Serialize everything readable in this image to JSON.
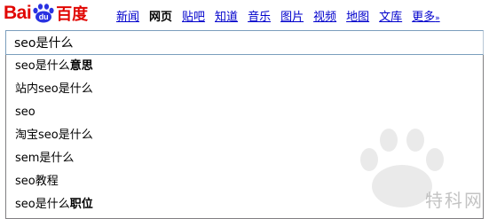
{
  "logo": {
    "text_left": "Bai",
    "text_paw": "du",
    "text_cn": "百度"
  },
  "nav": {
    "items": [
      {
        "label": "新闻",
        "active": false
      },
      {
        "label": "网页",
        "active": true
      },
      {
        "label": "贴吧",
        "active": false
      },
      {
        "label": "知道",
        "active": false
      },
      {
        "label": "音乐",
        "active": false
      },
      {
        "label": "图片",
        "active": false
      },
      {
        "label": "视频",
        "active": false
      },
      {
        "label": "地图",
        "active": false
      },
      {
        "label": "文库",
        "active": false
      }
    ],
    "more": {
      "label": "更多",
      "arrow": "»"
    }
  },
  "search": {
    "value": "seo是什么"
  },
  "suggestions": [
    {
      "prefix": "seo是什么",
      "bold": "意思"
    },
    {
      "prefix": "站内seo是什么",
      "bold": ""
    },
    {
      "prefix": "seo",
      "bold": ""
    },
    {
      "prefix": "淘宝seo是什么",
      "bold": ""
    },
    {
      "prefix": "sem是什么",
      "bold": ""
    },
    {
      "prefix": "seo教程",
      "bold": ""
    },
    {
      "prefix": "seo是什么",
      "bold": "职位"
    }
  ],
  "watermark": {
    "text": "特科网"
  },
  "colors": {
    "brand_red": "#e10602",
    "link_blue": "#0000cc",
    "paw_blue": "#2932e1"
  }
}
